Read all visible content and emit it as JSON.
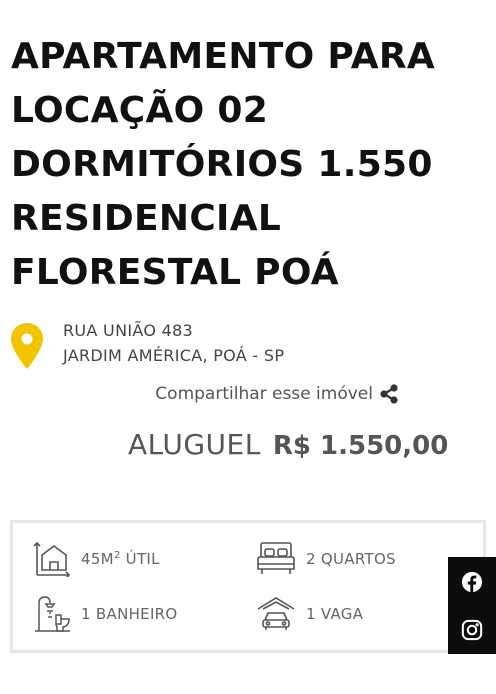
{
  "listing": {
    "title": "APARTAMENTO PARA LOCAÇÃO 02 DORMITÓRIOS 1.550 RESIDENCIAL FLORESTAL POÁ",
    "address": {
      "street": "RUA UNIÃO 483",
      "district": "JARDIM AMÉRICA, POÁ - SP"
    },
    "share_label": "Compartilhar esse imóvel",
    "price": {
      "label": "ALUGUEL",
      "value": "R$ 1.550,00"
    },
    "features": {
      "area_value": "45M",
      "area_sup": "2",
      "area_suffix": " ÚTIL",
      "rooms": "2 QUARTOS",
      "bathrooms": "1 BANHEIRO",
      "parking": "1 VAGA"
    }
  },
  "icons": {
    "pin": "location-pin-icon",
    "share": "share-icon",
    "area": "area-house-icon",
    "rooms": "bed-icon",
    "bath": "bathroom-icon",
    "parking": "garage-car-icon",
    "facebook": "facebook-icon",
    "instagram": "instagram-icon"
  },
  "colors": {
    "accent": "#f2c500",
    "text_dark": "#111111",
    "text_muted": "#555555",
    "social_bg": "#0c0c0c",
    "border": "#e6e6e6"
  }
}
